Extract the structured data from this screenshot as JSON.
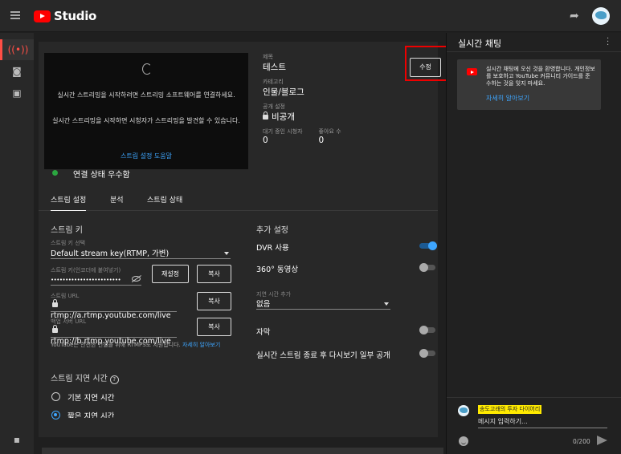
{
  "app": {
    "name": "Studio"
  },
  "rail": {
    "icons": [
      "live-stream-icon",
      "camera-icon",
      "calendar-icon",
      "feedback-icon"
    ]
  },
  "preview": {
    "message_1": "실시간 스트리밍을 시작하려면 스트리밍 소프트웨어를 연결하세요.",
    "message_2": "실시간 스트리밍을 시작하면 시청자가 스트리밍을 발견할 수 있습니다.",
    "help_link": "스트림 설정 도움말"
  },
  "details": {
    "title_label": "제목",
    "title_value": "테스트",
    "category_label": "카테고리",
    "category_value": "인물/블로그",
    "visibility_label": "공개 설정",
    "visibility_value": "비공개",
    "viewers_label": "대기 중인 시청자",
    "viewers_value": "0",
    "likes_label": "좋아요 수",
    "likes_value": "0",
    "edit_button": "수정"
  },
  "status": {
    "text": "연결 상태 우수함",
    "color": "#2ba640"
  },
  "tabs": [
    "스트림 설정",
    "분석",
    "스트림 상태"
  ],
  "stream_key": {
    "heading": "스트림 키",
    "select_label": "스트림 키 선택",
    "select_value": "Default stream key(RTMP, 가변)",
    "key_label": "스트림 키(인코더에 붙여넣기)",
    "key_value": "••••••••••••••••••••••••",
    "reset_button": "재설정",
    "copy_button": "복사",
    "url_label": "스트림 URL",
    "url_value": "rtmp://a.rtmp.youtube.com/live",
    "backup_label": "백업 서버 URL",
    "backup_value": "rtmp://b.rtmp.youtube.com/live",
    "note": "YouTube는 안전한 연결을 위해 RTMPS도 지원합니다.",
    "note_link": "자세히 알아보기"
  },
  "latency": {
    "heading": "스트림 지연 시간",
    "option_normal": "기본 지연 시간",
    "option_low": "짧은 지연 시간",
    "selected": "짧은 지연 시간"
  },
  "extra": {
    "heading": "추가 설정",
    "dvr_label": "DVR 사용",
    "dvr_on": true,
    "video360_label": "360° 동영상",
    "video360_on": false,
    "delay_label": "지연 시간 추가",
    "delay_value": "없음",
    "captions_label": "자막",
    "captions_on": false,
    "replay_label": "실시간 스트림 종료 후 다시보기 일부 공개",
    "replay_on": false
  },
  "chat": {
    "title": "실시간 채팅",
    "welcome": "실시간 채팅에 오신 것을 환영합니다. 개인정보를 보호하고 YouTube 커뮤니티 가이드를 준수하는 것을 잊지 마세요.",
    "learn_more": "자세히 알아보기",
    "username": "송도고래의 투자 다이어리",
    "input_placeholder": "메시지 입력하기...",
    "counter": "0/200"
  },
  "colors": {
    "accent": "#3ea6ff",
    "brand_red": "#ff0000",
    "highlight_box": "#e00000"
  }
}
